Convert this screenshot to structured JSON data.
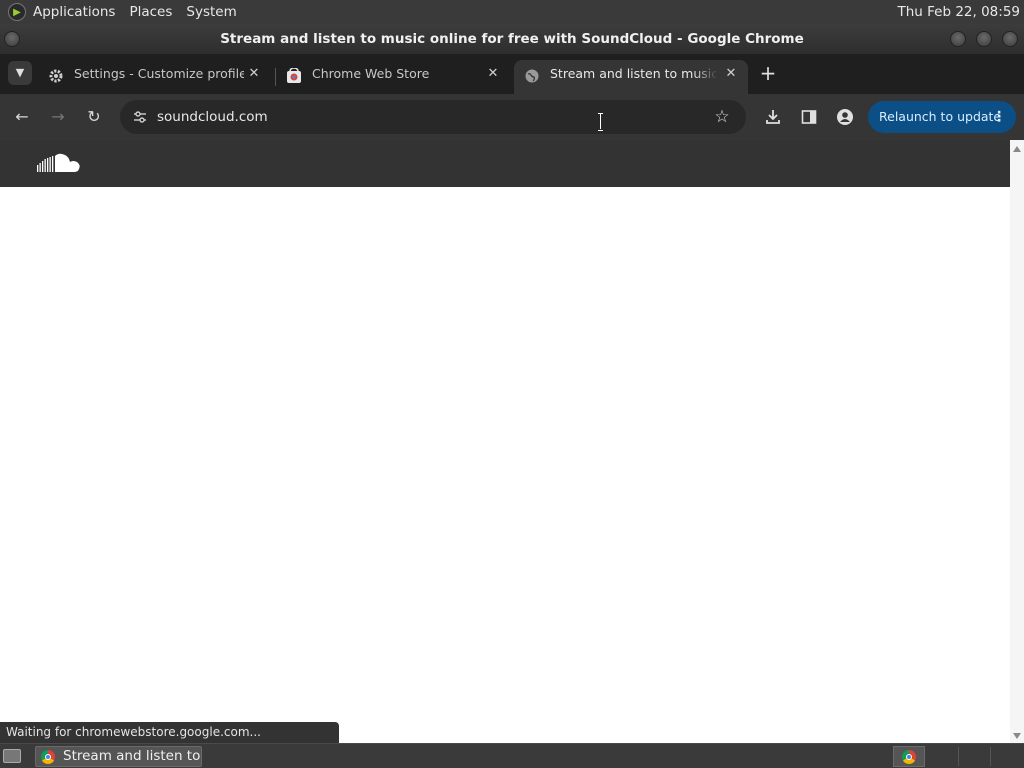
{
  "top_panel": {
    "menus": [
      "Applications",
      "Places",
      "System"
    ],
    "clock": "Thu Feb 22, 08:59"
  },
  "window": {
    "title": "Stream and listen to music online for free with SoundCloud - Google Chrome"
  },
  "tabs": [
    {
      "label": "Settings - Customize profile",
      "favicon": "gear-icon",
      "active": false
    },
    {
      "label": "Chrome Web Store",
      "favicon": "chrome-web-store-icon",
      "active": false
    },
    {
      "label": "Stream and listen to music or",
      "favicon": "globe-icon",
      "active": true
    }
  ],
  "toolbar": {
    "url": "soundcloud.com",
    "relaunch_label": "Relaunch to update"
  },
  "status_bubble": "Waiting for chromewebstore.google.com...",
  "taskbar": {
    "task_label": "Stream and listen to..."
  },
  "colors": {
    "relaunch_button": "#0b4f86",
    "soundcloud_header": "#333333",
    "page_background": "#ffffff"
  }
}
